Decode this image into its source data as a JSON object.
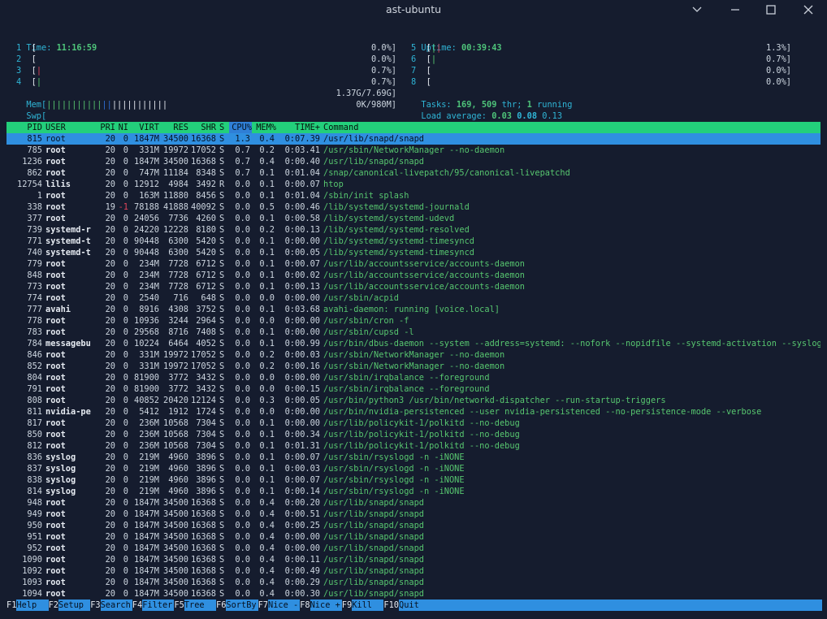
{
  "window": {
    "title": "ast-ubuntu",
    "minimize_icon": "chevron-down-icon",
    "restore_icon": "minimize-icon",
    "maximize_icon": "maximize-icon",
    "close_icon": "close-icon"
  },
  "header": {
    "time_label": "Time:",
    "time_value": "11:16:59",
    "uptime_label": "Uptime:",
    "uptime_value": "00:39:43",
    "cpus": [
      {
        "id": "1",
        "meter": "[",
        "percent": "0.0%]",
        "bars": ""
      },
      {
        "id": "2",
        "meter": "[",
        "percent": "0.0%]",
        "bars": ""
      },
      {
        "id": "3",
        "meter": "[",
        "percent": "0.7%]",
        "bars": "|"
      },
      {
        "id": "4",
        "meter": "[",
        "percent": "0.7%]",
        "bars": "|"
      },
      {
        "id": "5",
        "meter": "[",
        "percent": "1.3%]",
        "bars": "||"
      },
      {
        "id": "6",
        "meter": "[",
        "percent": "0.7%]",
        "bars": "|"
      },
      {
        "id": "7",
        "meter": "[",
        "percent": "0.0%]",
        "bars": ""
      },
      {
        "id": "8",
        "meter": "[",
        "percent": "0.0%]",
        "bars": ""
      }
    ],
    "mem_label": "Mem[",
    "mem_value": "1.37G/7.69G]",
    "swp_label": "Swp[",
    "swp_value": "0K/980M]",
    "tasks_label": "Tasks:",
    "tasks_count": "169,",
    "threads": "509",
    "thr_label": "thr;",
    "running_count": "1",
    "running_label": "running",
    "load_label": "Load average:",
    "load1": "0.03",
    "load5": "0.08",
    "load15": "0.13"
  },
  "columns": {
    "pid": "PID",
    "user": "USER",
    "pri": "PRI",
    "ni": "NI",
    "virt": "VIRT",
    "res": "RES",
    "shr": "SHR",
    "s": "S",
    "cpu": "CPU%",
    "mem": "MEM%",
    "time": "TIME+",
    "command": "Command"
  },
  "processes": [
    {
      "pid": "815",
      "user": "root",
      "pri": "20",
      "ni": "0",
      "virt": "1847M",
      "res": "34500",
      "shr": "16368",
      "s": "S",
      "cpu": "1.3",
      "mem": "0.4",
      "time": "0:07.39",
      "command": "/usr/lib/snapd/snapd"
    },
    {
      "pid": "785",
      "user": "root",
      "pri": "20",
      "ni": "0",
      "virt": "331M",
      "res": "19972",
      "shr": "17052",
      "s": "S",
      "cpu": "0.7",
      "mem": "0.2",
      "time": "0:03.41",
      "command": "/usr/sbin/NetworkManager --no-daemon"
    },
    {
      "pid": "1236",
      "user": "root",
      "pri": "20",
      "ni": "0",
      "virt": "1847M",
      "res": "34500",
      "shr": "16368",
      "s": "S",
      "cpu": "0.7",
      "mem": "0.4",
      "time": "0:00.40",
      "command": "/usr/lib/snapd/snapd"
    },
    {
      "pid": "862",
      "user": "root",
      "pri": "20",
      "ni": "0",
      "virt": "747M",
      "res": "11184",
      "shr": "8348",
      "s": "S",
      "cpu": "0.7",
      "mem": "0.1",
      "time": "0:01.04",
      "command": "/snap/canonical-livepatch/95/canonical-livepatchd"
    },
    {
      "pid": "12754",
      "user": "lilis",
      "pri": "20",
      "ni": "0",
      "virt": "12912",
      "res": "4984",
      "shr": "3492",
      "s": "R",
      "cpu": "0.0",
      "mem": "0.1",
      "time": "0:00.07",
      "command": "htop"
    },
    {
      "pid": "1",
      "user": "root",
      "pri": "20",
      "ni": "0",
      "virt": "163M",
      "res": "11880",
      "shr": "8456",
      "s": "S",
      "cpu": "0.0",
      "mem": "0.1",
      "time": "0:01.04",
      "command": "/sbin/init splash"
    },
    {
      "pid": "338",
      "user": "root",
      "pri": "19",
      "ni": "-1",
      "virt": "78188",
      "res": "41888",
      "shr": "40092",
      "s": "S",
      "cpu": "0.0",
      "mem": "0.5",
      "time": "0:00.46",
      "command": "/lib/systemd/systemd-journald"
    },
    {
      "pid": "377",
      "user": "root",
      "pri": "20",
      "ni": "0",
      "virt": "24056",
      "res": "7736",
      "shr": "4260",
      "s": "S",
      "cpu": "0.0",
      "mem": "0.1",
      "time": "0:00.58",
      "command": "/lib/systemd/systemd-udevd"
    },
    {
      "pid": "739",
      "user": "systemd-r",
      "pri": "20",
      "ni": "0",
      "virt": "24220",
      "res": "12228",
      "shr": "8180",
      "s": "S",
      "cpu": "0.0",
      "mem": "0.2",
      "time": "0:00.13",
      "command": "/lib/systemd/systemd-resolved"
    },
    {
      "pid": "771",
      "user": "systemd-t",
      "pri": "20",
      "ni": "0",
      "virt": "90448",
      "res": "6300",
      "shr": "5420",
      "s": "S",
      "cpu": "0.0",
      "mem": "0.1",
      "time": "0:00.00",
      "command": "/lib/systemd/systemd-timesyncd"
    },
    {
      "pid": "740",
      "user": "systemd-t",
      "pri": "20",
      "ni": "0",
      "virt": "90448",
      "res": "6300",
      "shr": "5420",
      "s": "S",
      "cpu": "0.0",
      "mem": "0.1",
      "time": "0:00.05",
      "command": "/lib/systemd/systemd-timesyncd"
    },
    {
      "pid": "779",
      "user": "root",
      "pri": "20",
      "ni": "0",
      "virt": "234M",
      "res": "7728",
      "shr": "6712",
      "s": "S",
      "cpu": "0.0",
      "mem": "0.1",
      "time": "0:00.07",
      "command": "/usr/lib/accountsservice/accounts-daemon"
    },
    {
      "pid": "848",
      "user": "root",
      "pri": "20",
      "ni": "0",
      "virt": "234M",
      "res": "7728",
      "shr": "6712",
      "s": "S",
      "cpu": "0.0",
      "mem": "0.1",
      "time": "0:00.02",
      "command": "/usr/lib/accountsservice/accounts-daemon"
    },
    {
      "pid": "773",
      "user": "root",
      "pri": "20",
      "ni": "0",
      "virt": "234M",
      "res": "7728",
      "shr": "6712",
      "s": "S",
      "cpu": "0.0",
      "mem": "0.1",
      "time": "0:00.13",
      "command": "/usr/lib/accountsservice/accounts-daemon"
    },
    {
      "pid": "774",
      "user": "root",
      "pri": "20",
      "ni": "0",
      "virt": "2540",
      "res": "716",
      "shr": "648",
      "s": "S",
      "cpu": "0.0",
      "mem": "0.0",
      "time": "0:00.00",
      "command": "/usr/sbin/acpid"
    },
    {
      "pid": "777",
      "user": "avahi",
      "pri": "20",
      "ni": "0",
      "virt": "8916",
      "res": "4308",
      "shr": "3752",
      "s": "S",
      "cpu": "0.0",
      "mem": "0.1",
      "time": "0:03.68",
      "command": "avahi-daemon: running [voice.local]"
    },
    {
      "pid": "778",
      "user": "root",
      "pri": "20",
      "ni": "0",
      "virt": "10936",
      "res": "3244",
      "shr": "2964",
      "s": "S",
      "cpu": "0.0",
      "mem": "0.0",
      "time": "0:00.00",
      "command": "/usr/sbin/cron -f"
    },
    {
      "pid": "783",
      "user": "root",
      "pri": "20",
      "ni": "0",
      "virt": "29568",
      "res": "8716",
      "shr": "7408",
      "s": "S",
      "cpu": "0.0",
      "mem": "0.1",
      "time": "0:00.00",
      "command": "/usr/sbin/cupsd -l"
    },
    {
      "pid": "784",
      "user": "messagebu",
      "pri": "20",
      "ni": "0",
      "virt": "10224",
      "res": "6464",
      "shr": "4052",
      "s": "S",
      "cpu": "0.0",
      "mem": "0.1",
      "time": "0:00.99",
      "command": "/usr/bin/dbus-daemon --system --address=systemd: --nofork --nopidfile --systemd-activation --syslog-on"
    },
    {
      "pid": "846",
      "user": "root",
      "pri": "20",
      "ni": "0",
      "virt": "331M",
      "res": "19972",
      "shr": "17052",
      "s": "S",
      "cpu": "0.0",
      "mem": "0.2",
      "time": "0:00.03",
      "command": "/usr/sbin/NetworkManager --no-daemon"
    },
    {
      "pid": "852",
      "user": "root",
      "pri": "20",
      "ni": "0",
      "virt": "331M",
      "res": "19972",
      "shr": "17052",
      "s": "S",
      "cpu": "0.0",
      "mem": "0.2",
      "time": "0:00.16",
      "command": "/usr/sbin/NetworkManager --no-daemon"
    },
    {
      "pid": "804",
      "user": "root",
      "pri": "20",
      "ni": "0",
      "virt": "81900",
      "res": "3772",
      "shr": "3432",
      "s": "S",
      "cpu": "0.0",
      "mem": "0.0",
      "time": "0:00.00",
      "command": "/usr/sbin/irqbalance --foreground"
    },
    {
      "pid": "791",
      "user": "root",
      "pri": "20",
      "ni": "0",
      "virt": "81900",
      "res": "3772",
      "shr": "3432",
      "s": "S",
      "cpu": "0.0",
      "mem": "0.0",
      "time": "0:00.15",
      "command": "/usr/sbin/irqbalance --foreground"
    },
    {
      "pid": "808",
      "user": "root",
      "pri": "20",
      "ni": "0",
      "virt": "40852",
      "res": "20420",
      "shr": "12124",
      "s": "S",
      "cpu": "0.0",
      "mem": "0.3",
      "time": "0:00.05",
      "command": "/usr/bin/python3 /usr/bin/networkd-dispatcher --run-startup-triggers"
    },
    {
      "pid": "811",
      "user": "nvidia-pe",
      "pri": "20",
      "ni": "0",
      "virt": "5412",
      "res": "1912",
      "shr": "1724",
      "s": "S",
      "cpu": "0.0",
      "mem": "0.0",
      "time": "0:00.00",
      "command": "/usr/bin/nvidia-persistenced --user nvidia-persistenced --no-persistence-mode --verbose"
    },
    {
      "pid": "817",
      "user": "root",
      "pri": "20",
      "ni": "0",
      "virt": "236M",
      "res": "10568",
      "shr": "7304",
      "s": "S",
      "cpu": "0.0",
      "mem": "0.1",
      "time": "0:00.00",
      "command": "/usr/lib/policykit-1/polkitd --no-debug"
    },
    {
      "pid": "850",
      "user": "root",
      "pri": "20",
      "ni": "0",
      "virt": "236M",
      "res": "10568",
      "shr": "7304",
      "s": "S",
      "cpu": "0.0",
      "mem": "0.1",
      "time": "0:00.34",
      "command": "/usr/lib/policykit-1/polkitd --no-debug"
    },
    {
      "pid": "812",
      "user": "root",
      "pri": "20",
      "ni": "0",
      "virt": "236M",
      "res": "10568",
      "shr": "7304",
      "s": "S",
      "cpu": "0.0",
      "mem": "0.1",
      "time": "0:01.31",
      "command": "/usr/lib/policykit-1/polkitd --no-debug"
    },
    {
      "pid": "836",
      "user": "syslog",
      "pri": "20",
      "ni": "0",
      "virt": "219M",
      "res": "4960",
      "shr": "3896",
      "s": "S",
      "cpu": "0.0",
      "mem": "0.1",
      "time": "0:00.07",
      "command": "/usr/sbin/rsyslogd -n -iNONE"
    },
    {
      "pid": "837",
      "user": "syslog",
      "pri": "20",
      "ni": "0",
      "virt": "219M",
      "res": "4960",
      "shr": "3896",
      "s": "S",
      "cpu": "0.0",
      "mem": "0.1",
      "time": "0:00.03",
      "command": "/usr/sbin/rsyslogd -n -iNONE"
    },
    {
      "pid": "838",
      "user": "syslog",
      "pri": "20",
      "ni": "0",
      "virt": "219M",
      "res": "4960",
      "shr": "3896",
      "s": "S",
      "cpu": "0.0",
      "mem": "0.1",
      "time": "0:00.07",
      "command": "/usr/sbin/rsyslogd -n -iNONE"
    },
    {
      "pid": "814",
      "user": "syslog",
      "pri": "20",
      "ni": "0",
      "virt": "219M",
      "res": "4960",
      "shr": "3896",
      "s": "S",
      "cpu": "0.0",
      "mem": "0.1",
      "time": "0:00.14",
      "command": "/usr/sbin/rsyslogd -n -iNONE"
    },
    {
      "pid": "948",
      "user": "root",
      "pri": "20",
      "ni": "0",
      "virt": "1847M",
      "res": "34500",
      "shr": "16368",
      "s": "S",
      "cpu": "0.0",
      "mem": "0.4",
      "time": "0:00.20",
      "command": "/usr/lib/snapd/snapd"
    },
    {
      "pid": "949",
      "user": "root",
      "pri": "20",
      "ni": "0",
      "virt": "1847M",
      "res": "34500",
      "shr": "16368",
      "s": "S",
      "cpu": "0.0",
      "mem": "0.4",
      "time": "0:00.51",
      "command": "/usr/lib/snapd/snapd"
    },
    {
      "pid": "950",
      "user": "root",
      "pri": "20",
      "ni": "0",
      "virt": "1847M",
      "res": "34500",
      "shr": "16368",
      "s": "S",
      "cpu": "0.0",
      "mem": "0.4",
      "time": "0:00.25",
      "command": "/usr/lib/snapd/snapd"
    },
    {
      "pid": "951",
      "user": "root",
      "pri": "20",
      "ni": "0",
      "virt": "1847M",
      "res": "34500",
      "shr": "16368",
      "s": "S",
      "cpu": "0.0",
      "mem": "0.4",
      "time": "0:00.00",
      "command": "/usr/lib/snapd/snapd"
    },
    {
      "pid": "952",
      "user": "root",
      "pri": "20",
      "ni": "0",
      "virt": "1847M",
      "res": "34500",
      "shr": "16368",
      "s": "S",
      "cpu": "0.0",
      "mem": "0.4",
      "time": "0:00.00",
      "command": "/usr/lib/snapd/snapd"
    },
    {
      "pid": "1090",
      "user": "root",
      "pri": "20",
      "ni": "0",
      "virt": "1847M",
      "res": "34500",
      "shr": "16368",
      "s": "S",
      "cpu": "0.0",
      "mem": "0.4",
      "time": "0:00.11",
      "command": "/usr/lib/snapd/snapd"
    },
    {
      "pid": "1092",
      "user": "root",
      "pri": "20",
      "ni": "0",
      "virt": "1847M",
      "res": "34500",
      "shr": "16368",
      "s": "S",
      "cpu": "0.0",
      "mem": "0.4",
      "time": "0:00.49",
      "command": "/usr/lib/snapd/snapd"
    },
    {
      "pid": "1093",
      "user": "root",
      "pri": "20",
      "ni": "0",
      "virt": "1847M",
      "res": "34500",
      "shr": "16368",
      "s": "S",
      "cpu": "0.0",
      "mem": "0.4",
      "time": "0:00.29",
      "command": "/usr/lib/snapd/snapd"
    },
    {
      "pid": "1094",
      "user": "root",
      "pri": "20",
      "ni": "0",
      "virt": "1847M",
      "res": "34500",
      "shr": "16368",
      "s": "S",
      "cpu": "0.0",
      "mem": "0.4",
      "time": "0:00.30",
      "command": "/usr/lib/snapd/snapd"
    }
  ],
  "footer": [
    {
      "key": "F1",
      "label": "Help  "
    },
    {
      "key": "F2",
      "label": "Setup "
    },
    {
      "key": "F3",
      "label": "Search"
    },
    {
      "key": "F4",
      "label": "Filter"
    },
    {
      "key": "F5",
      "label": "Tree  "
    },
    {
      "key": "F6",
      "label": "SortBy"
    },
    {
      "key": "F7",
      "label": "Nice -"
    },
    {
      "key": "F8",
      "label": "Nice +"
    },
    {
      "key": "F9",
      "label": "Kill  "
    },
    {
      "key": "F10",
      "label": "Quit"
    }
  ],
  "colors": {
    "bg": "#151c2e",
    "header_green": "#23cf7b",
    "select_blue": "#2f8fe0",
    "label_cyan": "#2fb5d6",
    "value_green": "#4ec47a",
    "negative_red": "#e0455a"
  }
}
